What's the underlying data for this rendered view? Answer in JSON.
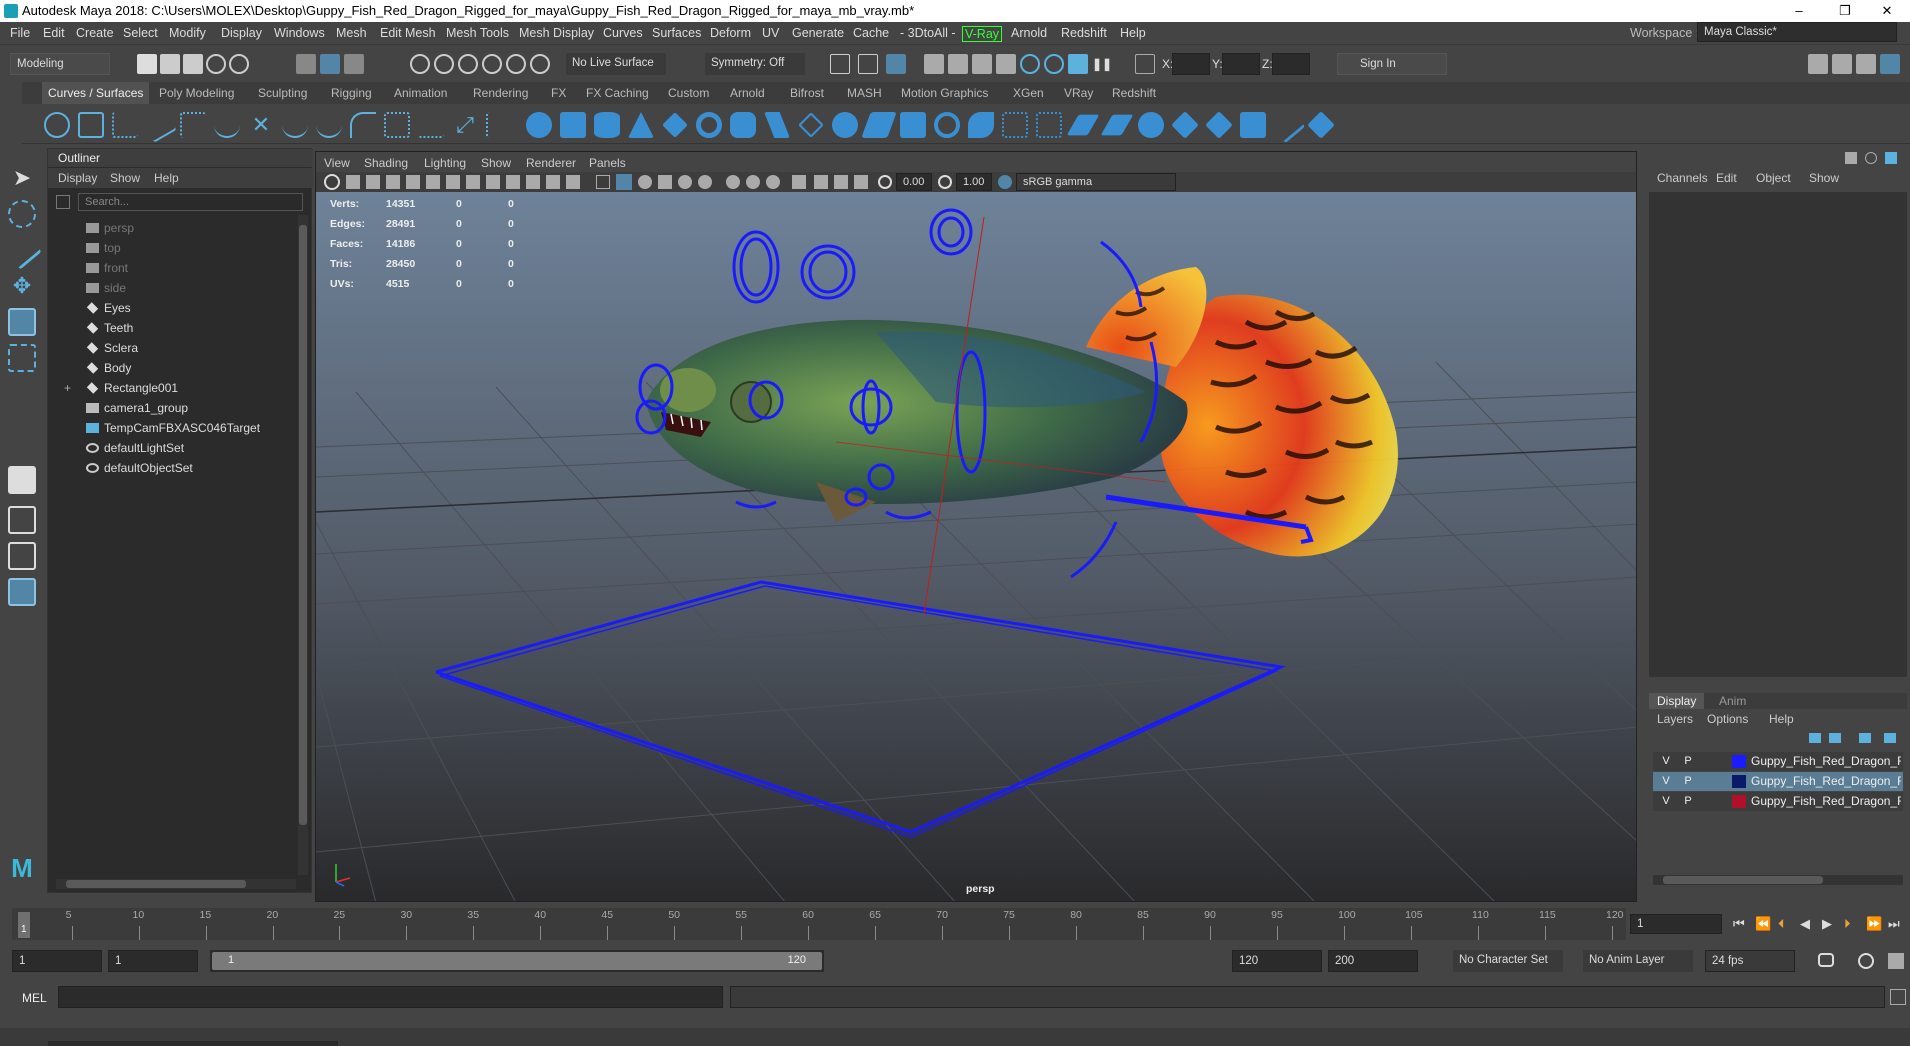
{
  "window": {
    "title": "Autodesk Maya 2018: C:\\Users\\MOLEX\\Desktop\\Guppy_Fish_Red_Dragon_Rigged_for_maya\\Guppy_Fish_Red_Dragon_Rigged_for_maya_mb_vray.mb*",
    "min": "–",
    "restore": "❐",
    "close": "✕"
  },
  "menus": [
    "File",
    "Edit",
    "Create",
    "Select",
    "Modify",
    "Display",
    "Windows",
    "Mesh",
    "Edit Mesh",
    "Mesh Tools",
    "Mesh Display",
    "Curves",
    "Surfaces",
    "Deform",
    "UV",
    "Generate",
    "Cache",
    "- 3DtoAll -",
    "V-Ray",
    "Arnold",
    "Redshift",
    "Help"
  ],
  "workspace": {
    "label": "Workspace :",
    "value": "Maya Classic*"
  },
  "status": {
    "mode": "Modeling",
    "live_surface": "No Live Surface",
    "symmetry": "Symmetry: Off",
    "x": "X:",
    "y": "Y:",
    "z": "Z:",
    "sign_in": "Sign In"
  },
  "shelf_tabs": [
    "Curves / Surfaces",
    "Poly Modeling",
    "Sculpting",
    "Rigging",
    "Animation",
    "Rendering",
    "FX",
    "FX Caching",
    "Custom",
    "Arnold",
    "Bifrost",
    "MASH",
    "Motion Graphics",
    "XGen",
    "VRay",
    "Redshift"
  ],
  "outliner": {
    "title": "Outliner",
    "menus": [
      "Display",
      "Show",
      "Help"
    ],
    "search_placeholder": "Search...",
    "items": [
      {
        "label": "persp",
        "dim": true,
        "icon": "camera-icon"
      },
      {
        "label": "top",
        "dim": true,
        "icon": "camera-icon"
      },
      {
        "label": "front",
        "dim": true,
        "icon": "camera-icon"
      },
      {
        "label": "side",
        "dim": true,
        "icon": "camera-icon"
      },
      {
        "label": "Eyes",
        "dim": false,
        "icon": "transform-icon"
      },
      {
        "label": "Teeth",
        "dim": false,
        "icon": "transform-icon"
      },
      {
        "label": "Sclera",
        "dim": false,
        "icon": "transform-icon"
      },
      {
        "label": "Body",
        "dim": false,
        "icon": "transform-icon"
      },
      {
        "label": "Rectangle001",
        "dim": false,
        "icon": "transform-icon",
        "expand": "+"
      },
      {
        "label": "camera1_group",
        "dim": false,
        "icon": "group-icon"
      },
      {
        "label": "TempCamFBXASC046Target",
        "dim": false,
        "icon": "locator-icon"
      },
      {
        "label": "defaultLightSet",
        "dim": false,
        "icon": "set-icon"
      },
      {
        "label": "defaultObjectSet",
        "dim": false,
        "icon": "set-icon"
      }
    ]
  },
  "viewport": {
    "menus": [
      "View",
      "Shading",
      "Lighting",
      "Show",
      "Renderer",
      "Panels"
    ],
    "near": "0.00",
    "far": "1.00",
    "colorspace": "sRGB gamma",
    "camera_label": "persp",
    "hud": [
      {
        "label": "Verts:",
        "a": "14351",
        "b": "0",
        "c": "0"
      },
      {
        "label": "Edges:",
        "a": "28491",
        "b": "0",
        "c": "0"
      },
      {
        "label": "Faces:",
        "a": "14186",
        "b": "0",
        "c": "0"
      },
      {
        "label": "Tris:",
        "a": "28450",
        "b": "0",
        "c": "0"
      },
      {
        "label": "UVs:",
        "a": "4515",
        "b": "0",
        "c": "0"
      }
    ]
  },
  "channel_box": {
    "menus": [
      "Channels",
      "Edit",
      "Object",
      "Show"
    ]
  },
  "layers": {
    "tabs": [
      "Display",
      "Anim"
    ],
    "menus": [
      "Layers",
      "Options",
      "Help"
    ],
    "rows": [
      {
        "v": "V",
        "p": "P",
        "color": "#1b1bff",
        "name": "Guppy_Fish_Red_Dragon_Rigged"
      },
      {
        "v": "V",
        "p": "P",
        "color": "#0a1a6a",
        "name": "Guppy_Fish_Red_Dragon_Rigged"
      },
      {
        "v": "V",
        "p": "P",
        "color": "#b0102a",
        "name": "Guppy_Fish_Red_Dragon_Rigged"
      }
    ]
  },
  "timeline": {
    "ticks": [
      "5",
      "10",
      "15",
      "20",
      "25",
      "30",
      "35",
      "40",
      "45",
      "50",
      "55",
      "60",
      "65",
      "70",
      "75",
      "80",
      "85",
      "90",
      "95",
      "100",
      "105",
      "110",
      "115",
      "120"
    ],
    "current_marker": "1",
    "current_frame": "1"
  },
  "range": {
    "start": "1",
    "anim_start": "1",
    "slider_start": "1",
    "slider_end": "120",
    "end": "120",
    "anim_end": "200",
    "character_set": "No Character Set",
    "anim_layer": "No Anim Layer",
    "fps": "24 fps"
  },
  "cmd": {
    "label": "MEL"
  },
  "colors": {
    "accent": "#5285a6",
    "wire": "#1a1aff",
    "bg_top": "#6c7f95",
    "bg_bottom": "#2c2c2e"
  }
}
